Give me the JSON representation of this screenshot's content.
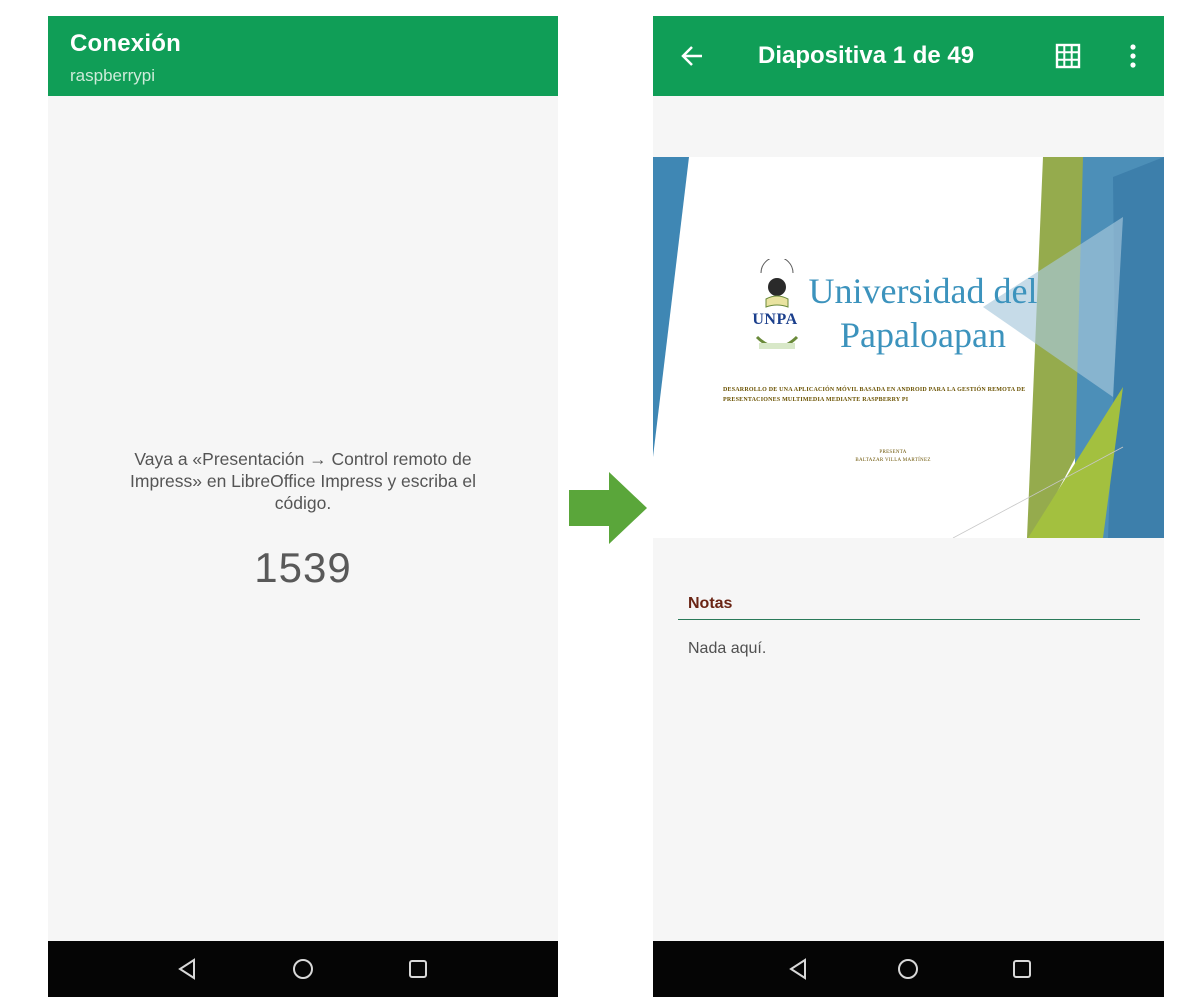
{
  "left_screen": {
    "appbar": {
      "title": "Conexión",
      "subtitle": "raspberrypi"
    },
    "pairing": {
      "instructions": "Vaya a «Presentación → Control remoto de Impress» en LibreOffice Impress y escriba el código.",
      "pin": "1539"
    },
    "navbar": {
      "back_icon": "back-triangle-icon",
      "home_icon": "home-circle-icon",
      "recents_icon": "recents-square-icon"
    }
  },
  "right_screen": {
    "appbar": {
      "title": "Diapositiva 1 de 49",
      "back_icon": "arrow-left-icon",
      "grid_icon": "grid-icon",
      "menu_icon": "more-vert-icon"
    },
    "slide": {
      "title_line1": "Universidad del",
      "title_line2": "Papaloapan",
      "logo_text": "UNPA",
      "body": "DESARROLLO DE UNA APLICACIÓN MÓVIL BASADA EN ANDROID PARA LA GESTIÓN REMOTA DE PRESENTACIONES MULTIMEDIA MEDIANTE RASPBERRY PI",
      "presenter_label": "PRESENTA",
      "presenter_name": "BALTAZAR VILLA MARTÍNEZ"
    },
    "notes": {
      "label": "Notas",
      "text": "Nada aquí."
    },
    "navbar": {
      "back_icon": "back-triangle-icon",
      "home_icon": "home-circle-icon",
      "recents_icon": "recents-square-icon"
    }
  },
  "colors": {
    "appbar": "#109e57",
    "nav_bar": "#050505",
    "arrow": "#5aa63a",
    "slide_title": "#3c93bd",
    "notes_label": "#6a2515"
  }
}
